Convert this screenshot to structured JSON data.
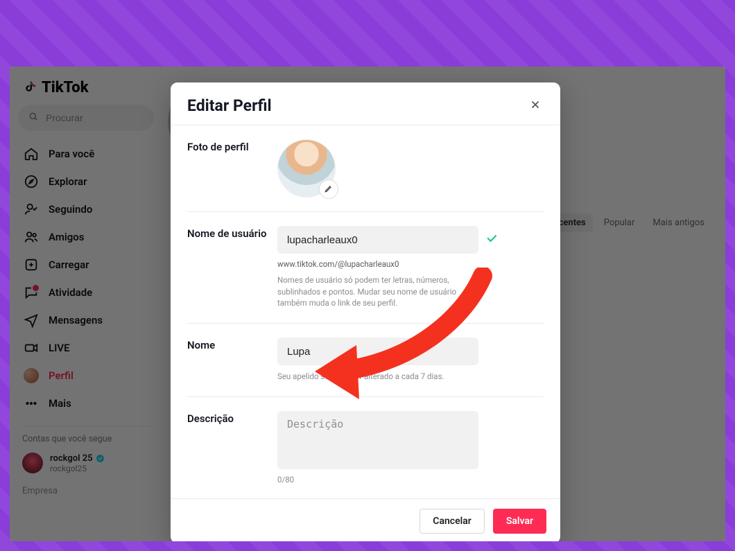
{
  "brand": {
    "name": "TikTok"
  },
  "search": {
    "placeholder": "Procurar"
  },
  "nav": {
    "for_you": "Para você",
    "explore": "Explorar",
    "following": "Seguindo",
    "friends": "Amigos",
    "upload": "Carregar",
    "activity": "Atividade",
    "messages": "Mensagens",
    "live": "LIVE",
    "profile": "Perfil",
    "more": "Mais"
  },
  "follow_section": {
    "title": "Contas que você segue",
    "account": {
      "display": "rockgol 25",
      "handle": "rockgol25"
    }
  },
  "footer_section": {
    "company": "Empresa"
  },
  "sort_tabs": {
    "recent": "Mais recentes",
    "popular": "Popular",
    "oldest": "Mais antigos"
  },
  "modal": {
    "title": "Editar Perfil",
    "sections": {
      "photo_label": "Foto de perfil",
      "username_label": "Nome de usuário",
      "name_label": "Nome",
      "bio_label": "Descrição"
    },
    "username": {
      "value": "lupacharleaux0",
      "url": "www.tiktok.com/@lupacharleaux0",
      "help": "Nomes de usuário só podem ter letras, números, sublinhados e pontos. Mudar seu nome de usuário também muda o link de seu perfil."
    },
    "name": {
      "value": "Lupa",
      "help": "Seu apelido só pode ser alterado a cada 7 dias."
    },
    "bio": {
      "placeholder": "Descrição",
      "counter": "0/80"
    },
    "buttons": {
      "cancel": "Cancelar",
      "save": "Salvar"
    }
  }
}
